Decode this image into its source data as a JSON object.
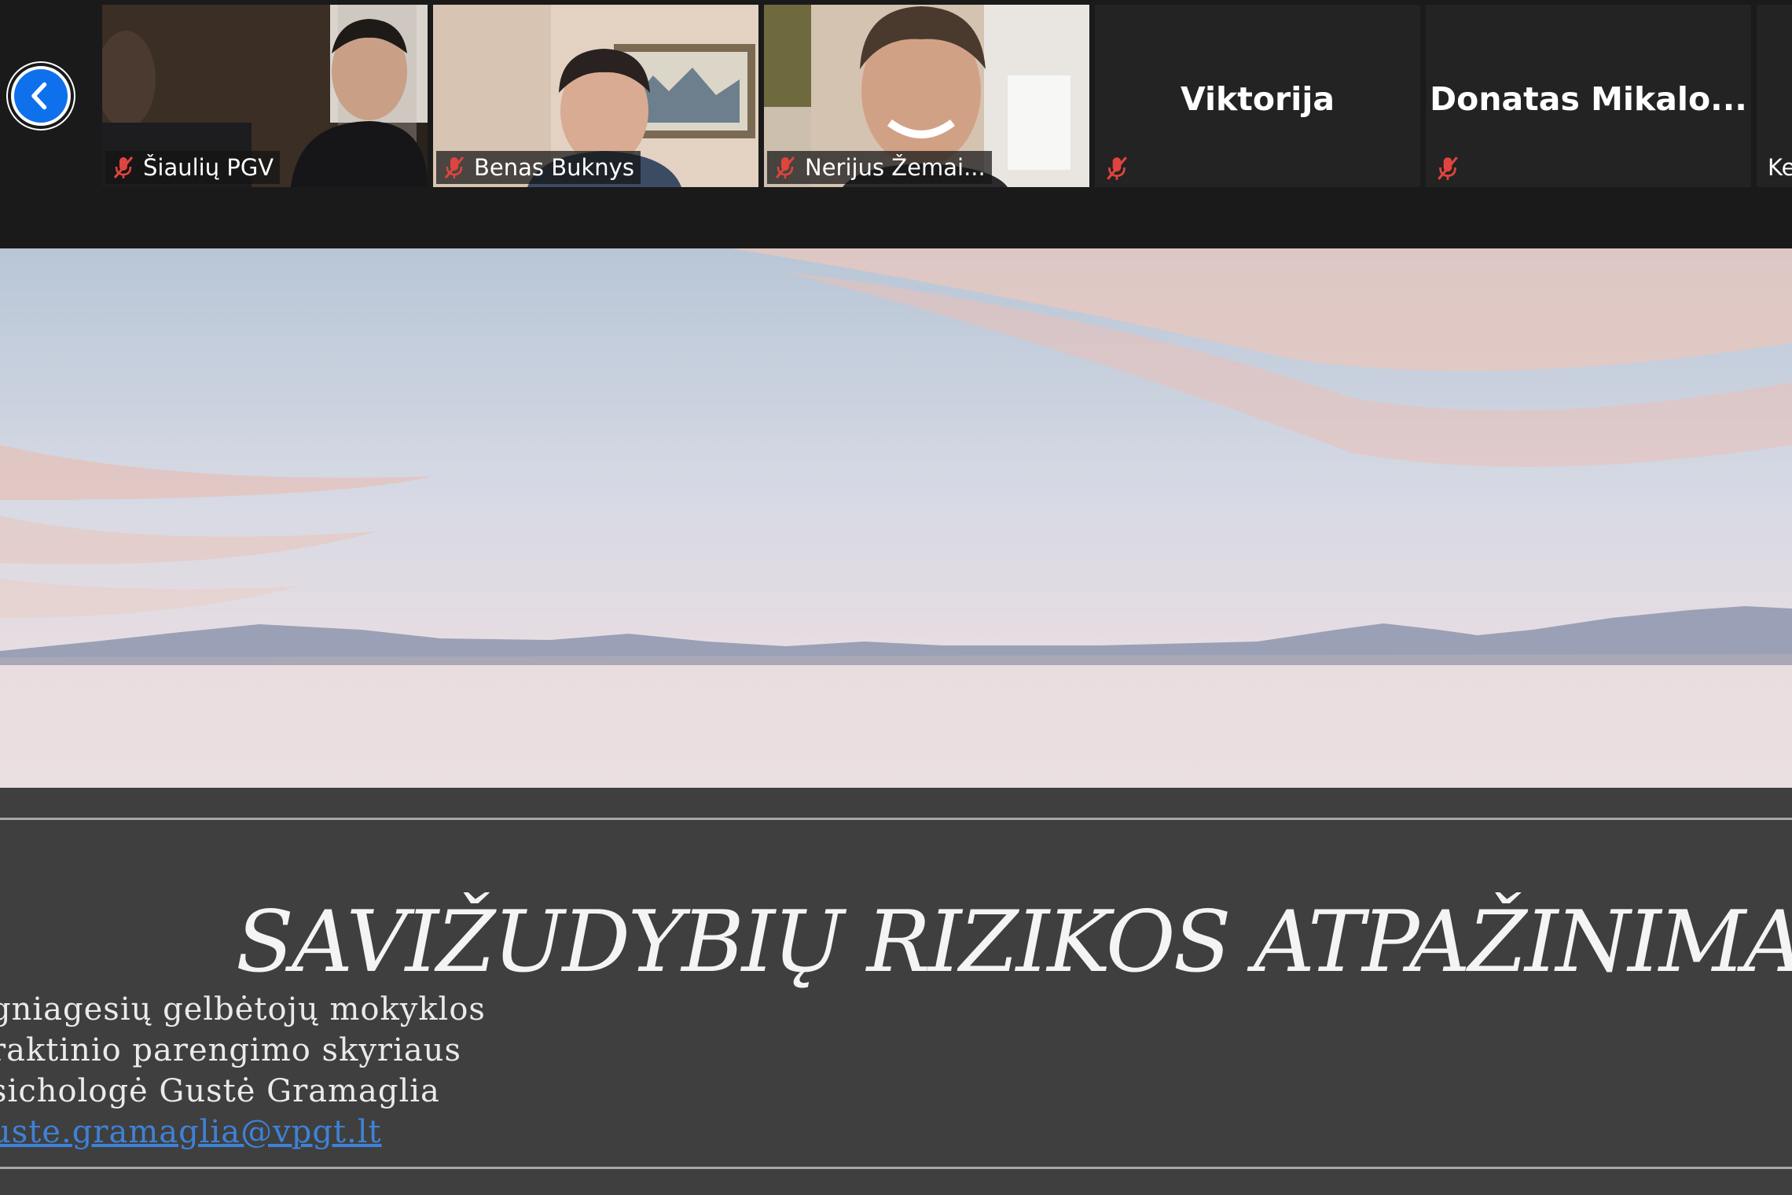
{
  "gallery": {
    "participants": [
      {
        "name": "Šiaulių PGV",
        "muted": true,
        "video": true
      },
      {
        "name": "Benas Buknys",
        "muted": true,
        "video": true
      },
      {
        "name": "Nerijus Žemai...",
        "muted": true,
        "video": true
      },
      {
        "name": "Viktorija",
        "muted": true,
        "video": false
      },
      {
        "name": "Donatas  Mikalo...",
        "muted": true,
        "video": false
      },
      {
        "name": "Ke",
        "muted": false,
        "video": false
      }
    ]
  },
  "slide": {
    "title": "SAVIŽUDYBIŲ RIZIKOS ATPAŽINIMAS",
    "author_lines": [
      "gniagesių gelbėtojų mokyklos",
      "raktinio parengimo skyriaus",
      "sichologė Gustė Gramaglia",
      "uste.gramaglia@vpgt.lt"
    ]
  },
  "colors": {
    "accent_blue": "#0e71eb",
    "mute_red": "#e0443e",
    "slide_background": "#3f3f3f",
    "link": "#3e82d6"
  }
}
